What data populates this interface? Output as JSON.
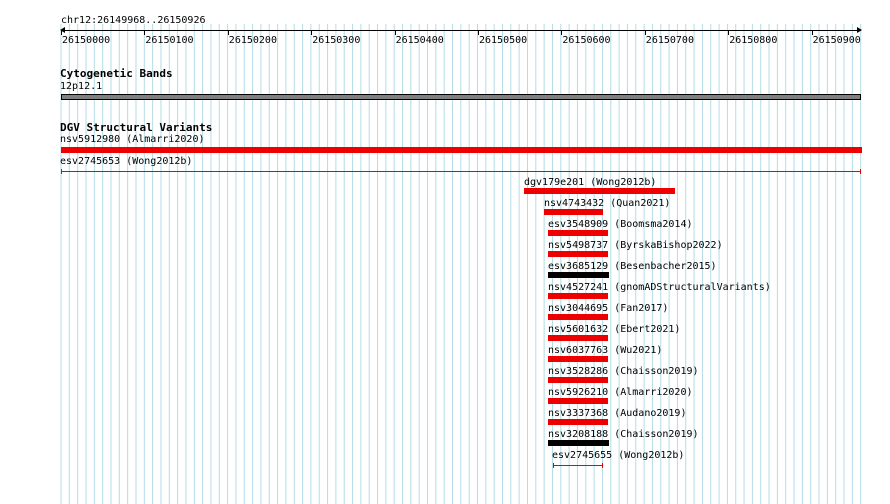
{
  "ruler": {
    "location": "chr12:26149968..26150926",
    "ticks": [
      "26150000",
      "26150100",
      "26150200",
      "26150300",
      "26150400",
      "26150500",
      "26150600",
      "26150700",
      "26150800",
      "26150900"
    ]
  },
  "cytoband_track": {
    "title": "Cytogenetic Bands",
    "band_label": "12p12.1",
    "band_color": "#808080"
  },
  "dgv_track": {
    "title": "DGV Structural Variants",
    "colors": {
      "red": "#ee0000",
      "black": "#000000"
    },
    "features": [
      {
        "id": "nsv5912980",
        "source": "(Almarri2020)",
        "color": "red",
        "style": "solid"
      },
      {
        "id": "esv2745653",
        "source": "(Wong2012b)",
        "color": "red",
        "style": "thin"
      },
      {
        "id": "dgv179e201",
        "source": "(Wong2012b)",
        "color": "red",
        "style": "solid"
      },
      {
        "id": "nsv4743432",
        "source": "(Quan2021)",
        "color": "red",
        "style": "solid"
      },
      {
        "id": "esv3548909",
        "source": "(Boomsma2014)",
        "color": "red",
        "style": "solid"
      },
      {
        "id": "nsv5498737",
        "source": "(ByrskaBishop2022)",
        "color": "red",
        "style": "solid"
      },
      {
        "id": "esv3685129",
        "source": "(Besenbacher2015)",
        "color": "black",
        "style": "solid"
      },
      {
        "id": "nsv4527241",
        "source": "(gnomADStructuralVariants)",
        "color": "red",
        "style": "solid"
      },
      {
        "id": "nsv3044695",
        "source": "(Fan2017)",
        "color": "red",
        "style": "solid"
      },
      {
        "id": "nsv5601632",
        "source": "(Ebert2021)",
        "color": "red",
        "style": "solid"
      },
      {
        "id": "nsv6037763",
        "source": "(Wu2021)",
        "color": "red",
        "style": "solid"
      },
      {
        "id": "nsv3528286",
        "source": "(Chaisson2019)",
        "color": "red",
        "style": "solid"
      },
      {
        "id": "nsv5926210",
        "source": "(Almarri2020)",
        "color": "red",
        "style": "solid"
      },
      {
        "id": "nsv3337368",
        "source": "(Audano2019)",
        "color": "red",
        "style": "solid"
      },
      {
        "id": "nsv3208188",
        "source": "(Chaisson2019)",
        "color": "black",
        "style": "solid"
      },
      {
        "id": "esv2745655",
        "source": "(Wong2012b)",
        "color": "red",
        "style": "thin"
      }
    ]
  }
}
